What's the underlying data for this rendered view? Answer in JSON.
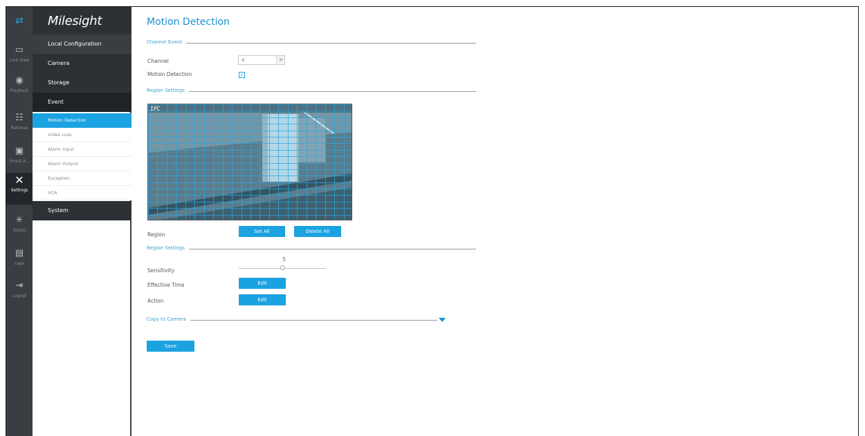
{
  "colors": {
    "accent": "#1ba2e0",
    "sidebar_dark": "#2d3035",
    "rail": "#3a3d42"
  },
  "brand": "Milesight",
  "rail": {
    "items": [
      {
        "label": "Live View",
        "icon": "live-view-icon"
      },
      {
        "label": "Playback",
        "icon": "playback-icon"
      },
      {
        "label": "Retrieve",
        "icon": "retrieve-icon"
      },
      {
        "label": "Smart A...",
        "icon": "smart-analysis-icon"
      },
      {
        "label": "Settings",
        "icon": "settings-icon"
      },
      {
        "label": "Status",
        "icon": "status-icon"
      },
      {
        "label": "Logs",
        "icon": "logs-icon"
      },
      {
        "label": "Logout",
        "icon": "logout-icon"
      }
    ]
  },
  "menu": {
    "local_configuration": "Local Configuration",
    "camera": "Camera",
    "storage": "Storage",
    "event": "Event",
    "event_items": [
      "Motion Detection",
      "Video Loss",
      "Alarm Input",
      "Alarm Output",
      "Exception",
      "VCA"
    ],
    "system": "System"
  },
  "page": {
    "title": "Motion Detection",
    "channel_event_section": "Channel Event",
    "channel_label": "Channel",
    "channel_value": "4",
    "motion_detection_label": "Motion Detection",
    "motion_detection_checked": true,
    "region_settings_section": "Region Settings",
    "video_osd_left": "IPC",
    "video_osd_right": "",
    "region_label": "Region",
    "set_all_button": "Set All",
    "delete_all_button": "Delete All",
    "region_settings_section_2": "Region Settings",
    "sensitivity_label": "Sensitivity",
    "sensitivity_value": "5",
    "sensitivity_level": 5,
    "effective_time_label": "Effective Time",
    "effective_time_button": "Edit",
    "action_label": "Action",
    "action_button": "Edit",
    "copy_to_camera_section": "Copy to Camera",
    "save_button": "Save"
  }
}
